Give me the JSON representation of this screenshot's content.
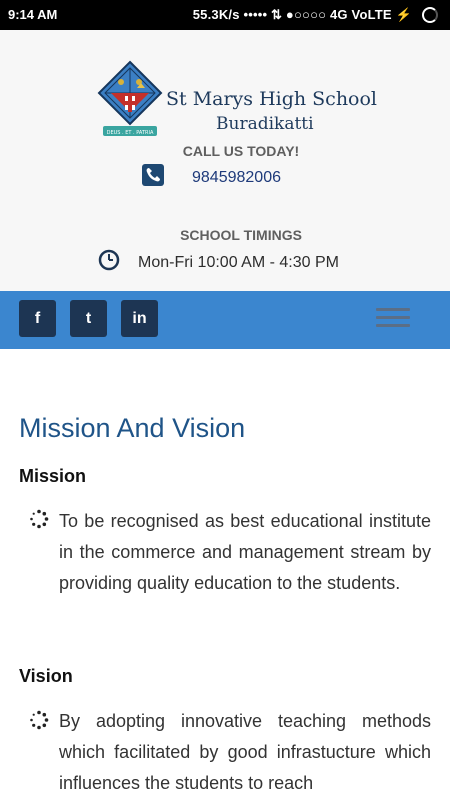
{
  "status_bar": {
    "time": "9:14 AM",
    "indicators": "55.3K/s ••••• ⇅ ●○○○○ 4G VoLTE ⚡"
  },
  "header": {
    "school_name": "St Marys High School",
    "school_place": "Buradikatti",
    "call_label": "CALL US TODAY!",
    "phone": "9845982006",
    "timings_label": "SCHOOL TIMINGS",
    "timings": "Mon-Fri 10:00 AM - 4:30 PM"
  },
  "social": {
    "facebook": "f",
    "twitter": "t",
    "linkedin": "in"
  },
  "main": {
    "title": "Mission And Vision",
    "mission_heading": "Mission",
    "mission_text": "To be recognised as best educational institute in the commerce and management stream by providing quality education to the students.",
    "vision_heading": "Vision",
    "vision_text": "By adopting innovative teaching methods which facilitated by good infrastucture which influences the students to reach"
  },
  "colors": {
    "nav_bar": "#3b86cf",
    "social_btn": "#1d3553",
    "title": "#1f5488"
  }
}
